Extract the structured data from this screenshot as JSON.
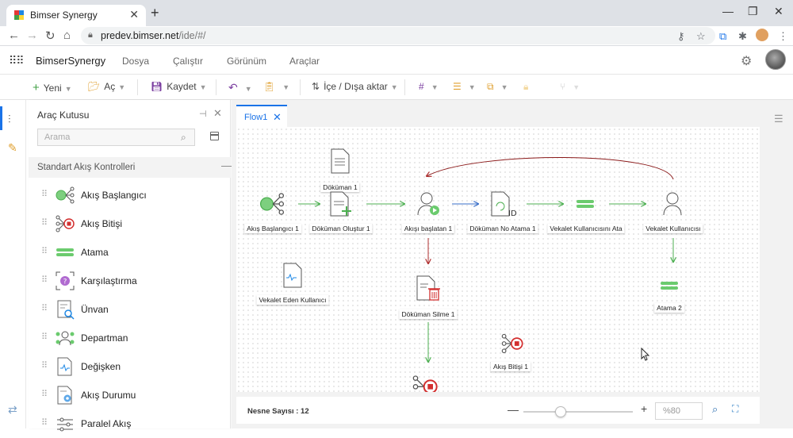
{
  "browser": {
    "tab_title": "Bimser Synergy",
    "url_host": "predev.bimser.net",
    "url_path": "/ide/#/"
  },
  "app": {
    "brand": "BimserSynergy",
    "menu": [
      "Dosya",
      "Çalıştır",
      "Görünüm",
      "Araçlar"
    ]
  },
  "toolbar": {
    "new_label": "Yeni",
    "open_label": "Aç",
    "save_label": "Kaydet",
    "import_export_label": "İçe / Dışa aktar"
  },
  "toolbox": {
    "title": "Araç Kutusu",
    "search_placeholder": "Arama",
    "section_title": "Standart Akış Kontrolleri",
    "items": [
      {
        "label": "Akış Başlangıcı",
        "icon": "flow-start-icon"
      },
      {
        "label": "Akış Bitişi",
        "icon": "flow-end-icon"
      },
      {
        "label": "Atama",
        "icon": "assignment-icon"
      },
      {
        "label": "Karşılaştırma",
        "icon": "comparison-icon"
      },
      {
        "label": "Ünvan",
        "icon": "title-icon"
      },
      {
        "label": "Departman",
        "icon": "department-icon"
      },
      {
        "label": "Değişken",
        "icon": "variable-icon"
      },
      {
        "label": "Akış Durumu",
        "icon": "flow-status-icon"
      },
      {
        "label": "Paralel Akış",
        "icon": "parallel-flow-icon"
      }
    ]
  },
  "editor": {
    "tab_label": "Flow1",
    "nodes": [
      {
        "id": "start",
        "label": "Akış Başlangıcı 1",
        "icon": "flow-start-icon"
      },
      {
        "id": "doc1",
        "label": "Döküman 1",
        "icon": "document-icon"
      },
      {
        "id": "createdoc",
        "label": "Döküman Oluştur 1",
        "icon": "document-create-icon"
      },
      {
        "id": "flowstarter",
        "label": "Akışı başlatan 1",
        "icon": "user-start-icon"
      },
      {
        "id": "docno",
        "label": "Döküman No Atama 1",
        "icon": "document-id-icon"
      },
      {
        "id": "assignproxy",
        "label": "Vekalet Kullanıcısını Ata",
        "icon": "assignment-icon"
      },
      {
        "id": "proxyuser",
        "label": "Vekalet Kullanıcısı",
        "icon": "user-icon"
      },
      {
        "id": "proxygiver",
        "label": "Vekalet Eden Kullanıcı",
        "icon": "document-wave-icon"
      },
      {
        "id": "deletedoc",
        "label": "Döküman Silme 1",
        "icon": "document-delete-icon"
      },
      {
        "id": "assign2",
        "label": "Atama 2",
        "icon": "assignment-icon"
      },
      {
        "id": "end1",
        "label": "Akış Bitişi 1",
        "icon": "flow-end-icon"
      }
    ],
    "object_count_label": "Nesne Sayısı : 12",
    "zoom_value": "%80"
  },
  "colors": {
    "accent": "#1a73e8",
    "green": "#4caf50",
    "red": "#d32f2f",
    "dark_red": "#8b1a1a"
  }
}
